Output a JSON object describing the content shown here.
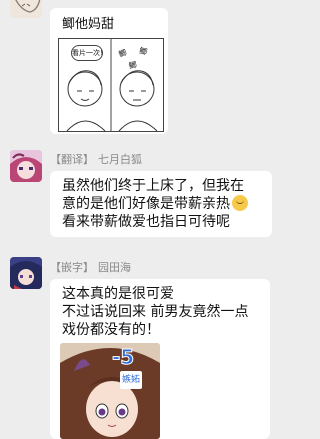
{
  "messages": [
    {
      "sender": null,
      "text_lines": [
        "鲫他妈甜"
      ],
      "has_image": true,
      "image": {
        "panel_left_text": "看片一次!",
        "panel_right_text_1": "鲫",
        "panel_right_text_2": "鲫",
        "panel_right_text_3": "鲫"
      }
    },
    {
      "sender": {
        "tag": "【翻译】",
        "name": "七月白狐"
      },
      "text_lines": [
        "虽然他们终于上床了，但我在",
        "意的是他们好像是带薪亲热",
        "看来带薪做爱也指日可待呢"
      ],
      "emoji": "face-with-hand-icon"
    },
    {
      "sender": {
        "tag": "【嵌字】",
        "name": "园田海"
      },
      "text_lines": [
        "这本真的是很可爱",
        "不过话说回来 前男友竟然一点",
        "戏份都没有的！"
      ],
      "has_image": true,
      "image": {
        "badge": "-5",
        "sub_badge": "嫉妬"
      }
    }
  ],
  "colors": {
    "background": "#ededed",
    "bubble": "#ffffff",
    "sender_text": "#8a8a8a",
    "badge": "#2f6cd8"
  }
}
